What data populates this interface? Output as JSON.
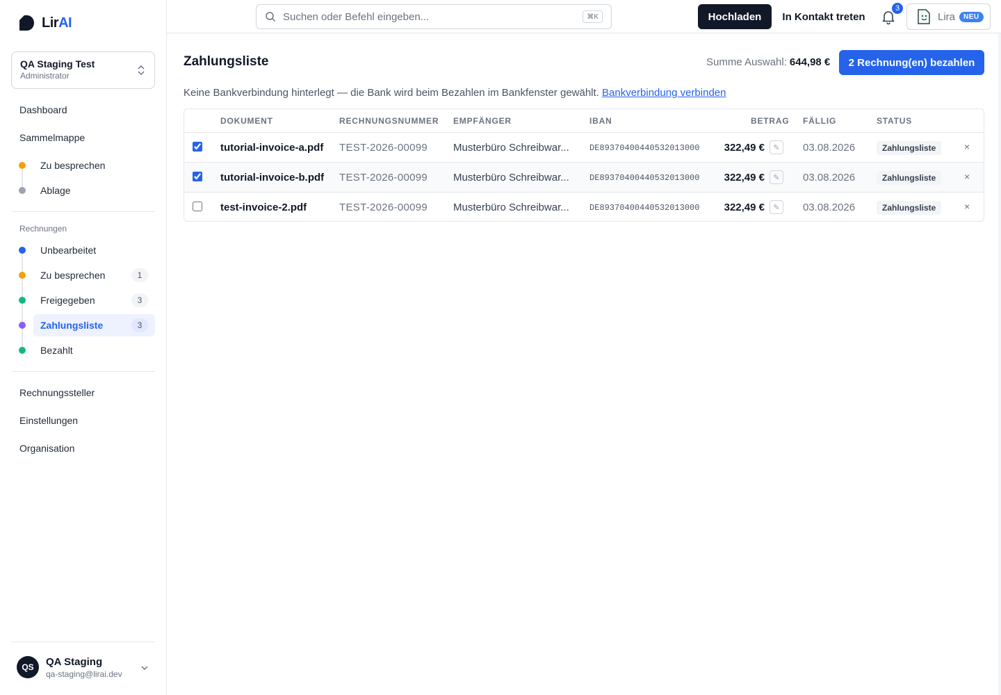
{
  "brand": {
    "name_prefix": "Lir",
    "name_suffix": "AI"
  },
  "org": {
    "name": "QA Staging Test",
    "role": "Administrator"
  },
  "nav": {
    "dashboard": "Dashboard",
    "sammelmappe": "Sammelmappe",
    "sammelmappe_sub": [
      {
        "label": "Zu besprechen",
        "color": "#f59e0b"
      },
      {
        "label": "Ablage",
        "color": "#9ca3af"
      }
    ],
    "rechnungen_label": "Rechnungen",
    "rechnungen_sub": [
      {
        "label": "Unbearbeitet",
        "color": "#2563eb",
        "count": ""
      },
      {
        "label": "Zu besprechen",
        "color": "#f59e0b",
        "count": "1"
      },
      {
        "label": "Freigegeben",
        "color": "#10b981",
        "count": "3"
      },
      {
        "label": "Zahlungsliste",
        "color": "#8b5cf6",
        "count": "3",
        "active": true
      },
      {
        "label": "Bezahlt",
        "color": "#10b981",
        "count": ""
      }
    ],
    "rechnungssteller": "Rechnungssteller",
    "einstellungen": "Einstellungen",
    "organisation": "Organisation"
  },
  "user": {
    "initials": "QS",
    "name": "QA Staging",
    "email": "qa-staging@lirai.dev"
  },
  "topbar": {
    "search_placeholder": "Suchen oder Befehl eingeben...",
    "search_shortcut": "⌘K",
    "upload": "Hochladen",
    "contact": "In Kontakt treten",
    "notification_count": "3",
    "assistant_label": "Lira",
    "assistant_badge": "NEU"
  },
  "page": {
    "title": "Zahlungsliste",
    "sum_label": "Summe Auswahl:",
    "sum_value": "644,98 €",
    "pay_button": "2 Rechnung(en) bezahlen",
    "notice_text": "Keine Bankverbindung hinterlegt — die Bank wird beim Bezahlen im Bankfenster gewählt.",
    "notice_link": "Bankverbindung verbinden"
  },
  "table": {
    "columns": [
      "DOKUMENT",
      "RECHNUNGSNUMMER",
      "EMPFÄNGER",
      "IBAN",
      "BETRAG",
      "FÄLLIG",
      "STATUS"
    ],
    "rows": [
      {
        "checked": true,
        "document": "tutorial-invoice-a.pdf",
        "number": "TEST-2026-00099",
        "recipient": "Musterbüro Schreibwar...",
        "iban": "DE89370400440532013000",
        "amount": "322,49 €",
        "due": "03.08.2026",
        "status": "Zahlungsliste"
      },
      {
        "checked": true,
        "document": "tutorial-invoice-b.pdf",
        "number": "TEST-2026-00099",
        "recipient": "Musterbüro Schreibwar...",
        "iban": "DE89370400440532013000",
        "amount": "322,49 €",
        "due": "03.08.2026",
        "status": "Zahlungsliste"
      },
      {
        "checked": false,
        "document": "test-invoice-2.pdf",
        "number": "TEST-2026-00099",
        "recipient": "Musterbüro Schreibwar...",
        "iban": "DE89370400440532013000",
        "amount": "322,49 €",
        "due": "03.08.2026",
        "status": "Zahlungsliste"
      }
    ]
  }
}
